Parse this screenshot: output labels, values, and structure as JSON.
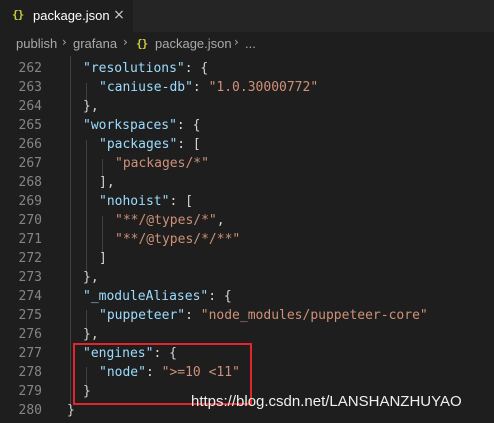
{
  "tab": {
    "icon": "{}",
    "title": "package.json",
    "close_icon": "×"
  },
  "breadcrumb": {
    "items": [
      "publish",
      "grafana",
      "package.json",
      "..."
    ],
    "separator": "›",
    "json_icon": "{}"
  },
  "editor": {
    "lines": [
      {
        "n": "262"
      },
      {
        "n": "263"
      },
      {
        "n": "264"
      },
      {
        "n": "265"
      },
      {
        "n": "266"
      },
      {
        "n": "267"
      },
      {
        "n": "268"
      },
      {
        "n": "269"
      },
      {
        "n": "270"
      },
      {
        "n": "271"
      },
      {
        "n": "272"
      },
      {
        "n": "273"
      },
      {
        "n": "274"
      },
      {
        "n": "275"
      },
      {
        "n": "276"
      },
      {
        "n": "277"
      },
      {
        "n": "278"
      },
      {
        "n": "279"
      },
      {
        "n": "280"
      }
    ],
    "code": {
      "k_resolutions": "\"resolutions\"",
      "k_caniuse": "\"caniuse-db\"",
      "v_caniuse": "\"1.0.30000772\"",
      "k_workspaces": "\"workspaces\"",
      "k_packages": "\"packages\"",
      "v_packages": "\"packages/*\"",
      "k_nohoist": "\"nohoist\"",
      "v_types": "\"**/@types/*\"",
      "v_types_all": "\"**/@types/*/**\"",
      "k_module_aliases": "\"_moduleAliases\"",
      "k_puppeteer": "\"puppeteer\"",
      "v_puppeteer": "\"node_modules/puppeteer-core\"",
      "k_engines": "\"engines\"",
      "k_node": "\"node\"",
      "v_node": "\">=10 <11\""
    }
  },
  "watermark": "https://blog.csdn.net/LANSHANZHUYAO",
  "colors": {
    "background": "#1e1e1e",
    "key": "#9cdcfe",
    "string": "#ce9178",
    "line_number": "#858585",
    "highlight_box": "#e0252b"
  }
}
